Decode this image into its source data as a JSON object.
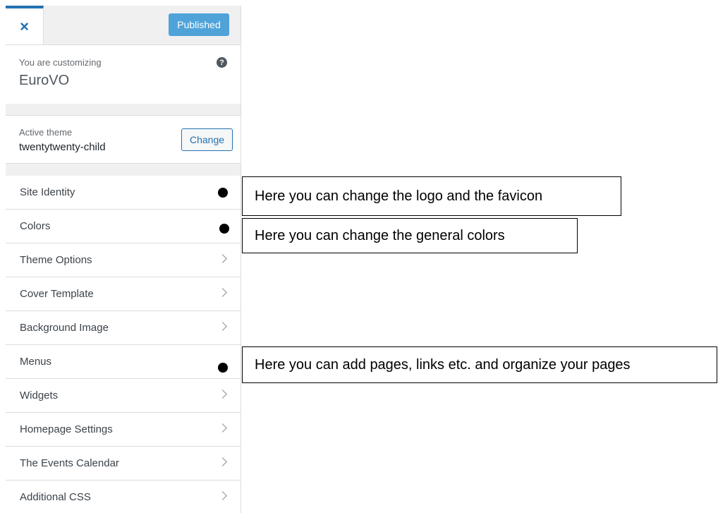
{
  "header": {
    "close_icon": "×",
    "publish_label": "Published"
  },
  "customizing": {
    "label": "You are customizing",
    "site_name": "EuroVO",
    "help_icon": "?"
  },
  "theme": {
    "label": "Active theme",
    "name": "twentytwenty-child",
    "change_label": "Change"
  },
  "menu": {
    "items": [
      {
        "label": "Site Identity"
      },
      {
        "label": "Colors"
      },
      {
        "label": "Theme Options"
      },
      {
        "label": "Cover Template"
      },
      {
        "label": "Background Image"
      },
      {
        "label": "Menus"
      },
      {
        "label": "Widgets"
      },
      {
        "label": "Homepage Settings"
      },
      {
        "label": "The Events Calendar"
      },
      {
        "label": "Additional CSS"
      }
    ]
  },
  "annotations": {
    "site_identity": "Here you can change the logo and the favicon",
    "colors": "Here you can change the general colors",
    "menus": "Here you can add pages, links etc. and organize your pages"
  },
  "colors": {
    "accent": "#2271b1",
    "publish_bg": "#4fa3d9",
    "panel_bg": "#f0f0f1"
  }
}
